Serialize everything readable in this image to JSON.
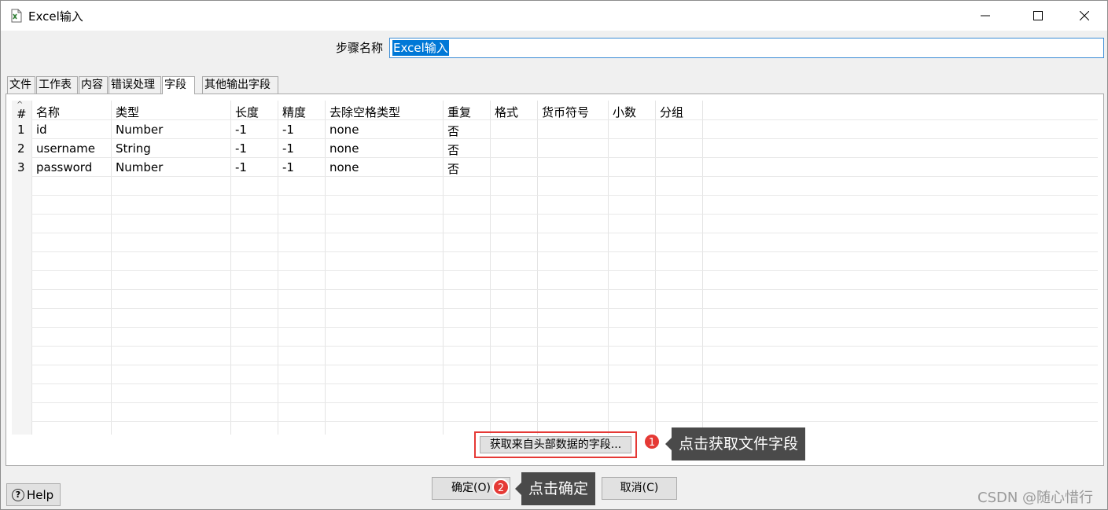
{
  "window": {
    "title": "Excel输入"
  },
  "step": {
    "label": "步骤名称",
    "value": "Excel输入"
  },
  "tabs": [
    {
      "label": "文件"
    },
    {
      "label": "工作表"
    },
    {
      "label": "内容"
    },
    {
      "label": "错误处理"
    },
    {
      "label": "字段",
      "active": true
    },
    {
      "label": "其他输出字段"
    }
  ],
  "table": {
    "columns": [
      "#",
      "名称",
      "类型",
      "长度",
      "精度",
      "去除空格类型",
      "重复",
      "格式",
      "货币符号",
      "小数",
      "分组"
    ],
    "rows": [
      [
        "1",
        "id",
        "Number",
        "-1",
        "-1",
        "none",
        "否"
      ],
      [
        "2",
        "username",
        "String",
        "-1",
        "-1",
        "none",
        "否"
      ],
      [
        "3",
        "password",
        "Number",
        "-1",
        "-1",
        "none",
        "否"
      ]
    ]
  },
  "get_fields_button": "获取来自头部数据的字段...",
  "annotations": [
    {
      "number": "1",
      "text": "点击获取文件字段"
    },
    {
      "number": "2",
      "text": "点击确定"
    }
  ],
  "buttons": {
    "help": "Help",
    "ok": "确定(O)",
    "cancel": "取消(C)"
  },
  "watermark": "CSDN @随心惜行",
  "colors": {
    "highlight": "#e53935",
    "callout_bg": "#4a4a4a",
    "selection": "#0078d7"
  }
}
